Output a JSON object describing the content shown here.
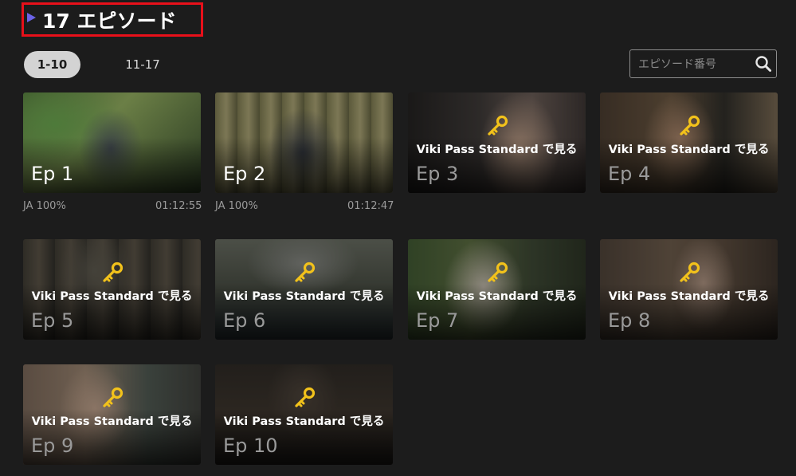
{
  "header": {
    "title": "17 エピソード",
    "accent_color": "#6b63e8",
    "highlight_color": "#e8101a"
  },
  "tabs": [
    {
      "label": "1-10",
      "active": true
    },
    {
      "label": "11-17",
      "active": false
    }
  ],
  "search": {
    "placeholder": "エピソード番号",
    "value": "",
    "icon": "search-icon"
  },
  "episodes": [
    {
      "label": "Ep 1",
      "subtitle": "JA 100%",
      "duration": "01:12:55",
      "locked": false
    },
    {
      "label": "Ep 2",
      "subtitle": "JA 100%",
      "duration": "01:12:47",
      "locked": false
    },
    {
      "label": "Ep 3",
      "watch": "Viki Pass Standard で見る",
      "locked": true
    },
    {
      "label": "Ep 4",
      "watch": "Viki Pass Standard で見る",
      "locked": true
    },
    {
      "label": "Ep 5",
      "watch": "Viki Pass Standard で見る",
      "locked": true
    },
    {
      "label": "Ep 6",
      "watch": "Viki Pass Standard で見る",
      "locked": true
    },
    {
      "label": "Ep 7",
      "watch": "Viki Pass Standard で見る",
      "locked": true
    },
    {
      "label": "Ep 8",
      "watch": "Viki Pass Standard で見る",
      "locked": true
    },
    {
      "label": "Ep 9",
      "watch": "Viki Pass Standard で見る",
      "locked": true
    },
    {
      "label": "Ep 10",
      "watch": "Viki Pass Standard で見る",
      "locked": true
    }
  ],
  "key_color": "#f2c21b"
}
